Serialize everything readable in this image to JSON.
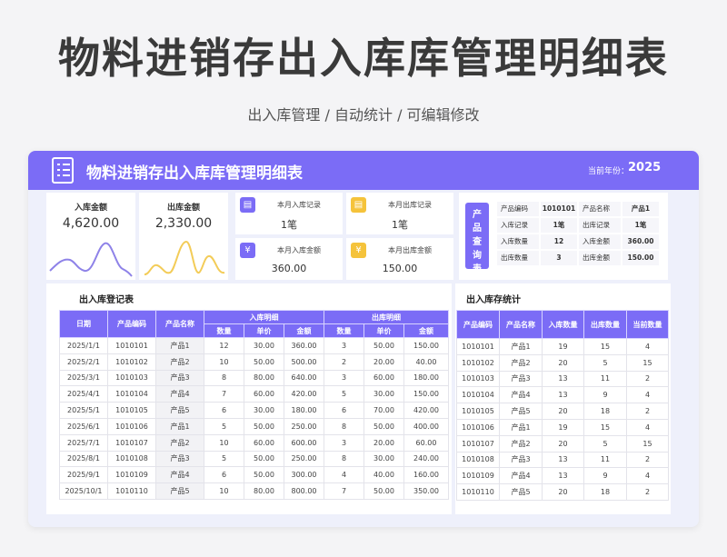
{
  "page": {
    "title": "物料进销存出入库库管理明细表",
    "subtitle": "出入库管理 /  自动统计  /  可编辑修改"
  },
  "header": {
    "title": "物料进销存出入库库管理明细表",
    "year_label": "当前年份：",
    "year_value": "2025",
    "icon": "document-list-icon"
  },
  "colors": {
    "accent": "#7b6cf6",
    "in_line": "#8e82e8",
    "out_line": "#f3cc58",
    "icon_purple": "#7b6cf6",
    "icon_yellow": "#f5c33b"
  },
  "kpis": [
    {
      "label": "入库金额",
      "value": "4,620.00"
    },
    {
      "label": "出库金额",
      "value": "2,330.00"
    }
  ],
  "stats": [
    {
      "label": "本月入库记录",
      "value": "1笔",
      "icon": "clipboard-icon"
    },
    {
      "label": "本月出库记录",
      "value": "1笔",
      "icon": "clipboard-icon"
    },
    {
      "label": "本月入库金额",
      "value": "360.00",
      "icon": "money-icon"
    },
    {
      "label": "本月出库金额",
      "value": "150.00",
      "icon": "money-icon"
    }
  ],
  "query": {
    "tag": [
      "产",
      "品",
      "查",
      "询",
      "表"
    ],
    "rows": [
      {
        "l1": "产品编码",
        "v1": "1010101",
        "l2": "产品名称",
        "v2": "产品1"
      },
      {
        "l1": "入库记录",
        "v1": "1笔",
        "l2": "出库记录",
        "v2": "1笔"
      },
      {
        "l1": "入库数量",
        "v1": "12",
        "l2": "入库金额",
        "v2": "360.00"
      },
      {
        "l1": "出库数量",
        "v1": "3",
        "l2": "出库金额",
        "v2": "150.00"
      }
    ]
  },
  "register": {
    "title": "出入库登记表",
    "headers": {
      "date": "日期",
      "code": "产品编码",
      "name": "产品名称",
      "in_group": "入库明细",
      "out_group": "出库明细",
      "qty": "数量",
      "price": "单价",
      "amount": "金额"
    },
    "rows": [
      [
        "2025/1/1",
        "1010101",
        "产品1",
        "12",
        "30.00",
        "360.00",
        "3",
        "50.00",
        "150.00"
      ],
      [
        "2025/2/1",
        "1010102",
        "产品2",
        "10",
        "50.00",
        "500.00",
        "2",
        "20.00",
        "40.00"
      ],
      [
        "2025/3/1",
        "1010103",
        "产品3",
        "8",
        "80.00",
        "640.00",
        "3",
        "60.00",
        "180.00"
      ],
      [
        "2025/4/1",
        "1010104",
        "产品4",
        "7",
        "60.00",
        "420.00",
        "5",
        "30.00",
        "150.00"
      ],
      [
        "2025/5/1",
        "1010105",
        "产品5",
        "6",
        "30.00",
        "180.00",
        "6",
        "70.00",
        "420.00"
      ],
      [
        "2025/6/1",
        "1010106",
        "产品1",
        "5",
        "50.00",
        "250.00",
        "8",
        "50.00",
        "400.00"
      ],
      [
        "2025/7/1",
        "1010107",
        "产品2",
        "10",
        "60.00",
        "600.00",
        "3",
        "20.00",
        "60.00"
      ],
      [
        "2025/8/1",
        "1010108",
        "产品3",
        "5",
        "50.00",
        "250.00",
        "8",
        "30.00",
        "240.00"
      ],
      [
        "2025/9/1",
        "1010109",
        "产品4",
        "6",
        "50.00",
        "300.00",
        "4",
        "40.00",
        "160.00"
      ],
      [
        "2025/10/1",
        "1010110",
        "产品5",
        "10",
        "80.00",
        "800.00",
        "7",
        "50.00",
        "350.00"
      ]
    ]
  },
  "inventory": {
    "title": "出入库存统计",
    "headers": [
      "产品编码",
      "产品名称",
      "入库数量",
      "出库数量",
      "当前数量"
    ],
    "rows": [
      [
        "1010101",
        "产品1",
        "19",
        "15",
        "4"
      ],
      [
        "1010102",
        "产品2",
        "20",
        "5",
        "15"
      ],
      [
        "1010103",
        "产品3",
        "13",
        "11",
        "2"
      ],
      [
        "1010104",
        "产品4",
        "13",
        "9",
        "4"
      ],
      [
        "1010105",
        "产品5",
        "20",
        "18",
        "2"
      ],
      [
        "1010106",
        "产品1",
        "19",
        "15",
        "4"
      ],
      [
        "1010107",
        "产品2",
        "20",
        "5",
        "15"
      ],
      [
        "1010108",
        "产品3",
        "13",
        "11",
        "2"
      ],
      [
        "1010109",
        "产品4",
        "13",
        "9",
        "4"
      ],
      [
        "1010110",
        "产品5",
        "20",
        "18",
        "2"
      ]
    ]
  }
}
